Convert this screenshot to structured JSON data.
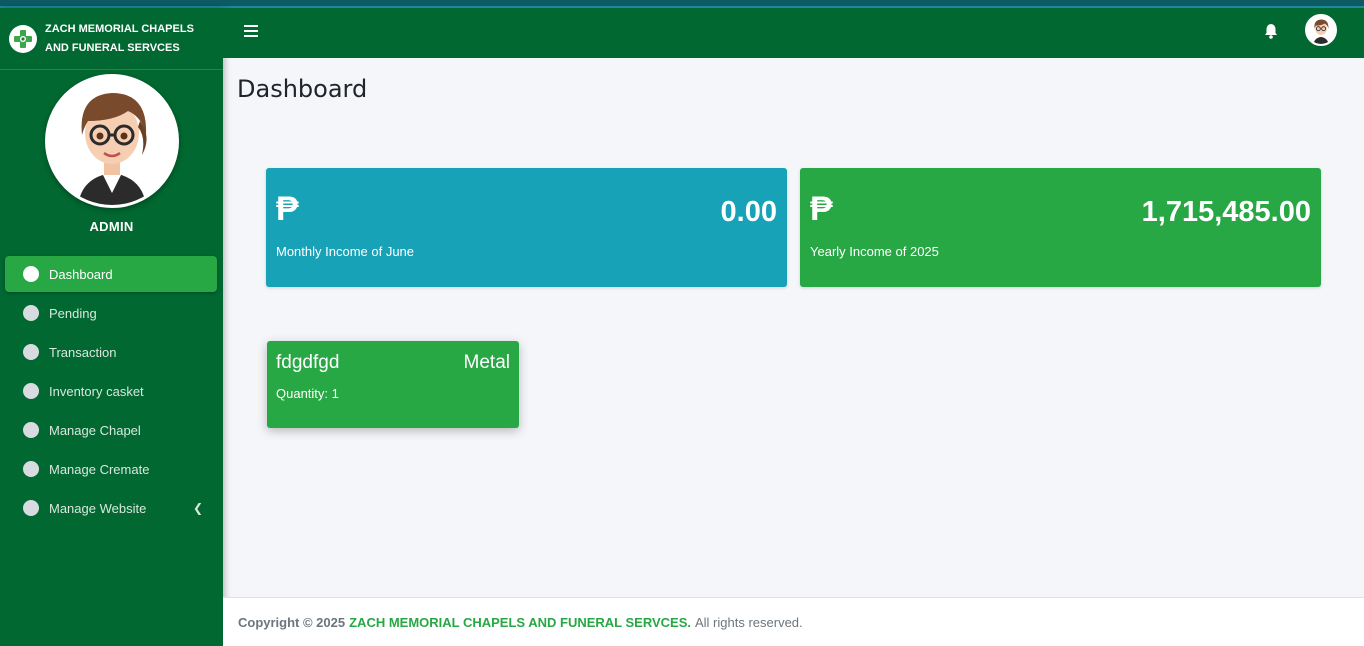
{
  "brand": {
    "line1": "ZACH MEMORIAL CHAPELS",
    "line2": "AND FUNERAL SERVCES",
    "logo_icon": "cross-emblem-icon"
  },
  "user": {
    "name": "ADMIN",
    "avatar_icon": "admin-avatar"
  },
  "sidebar": {
    "items": [
      {
        "label": "Dashboard",
        "active": true
      },
      {
        "label": "Pending"
      },
      {
        "label": "Transaction"
      },
      {
        "label": "Inventory casket"
      },
      {
        "label": "Manage Chapel"
      },
      {
        "label": "Manage Cremate"
      },
      {
        "label": "Manage Website",
        "icon": "chevron-left-icon"
      }
    ]
  },
  "header": {
    "menu_icon": "hamburger-icon",
    "notification_icon": "bell-icon"
  },
  "page": {
    "title": "Dashboard"
  },
  "cards": [
    {
      "symbol": "₱",
      "value": "0.00",
      "label": "Monthly Income of June",
      "color": "#17a2b8"
    },
    {
      "symbol": "₱",
      "value": "1,715,485.00",
      "label": "Yearly Income of 2025",
      "color": "#28a745"
    }
  ],
  "inventory": [
    {
      "name": "fdgdfgd",
      "type": "Metal",
      "quantity": "Quantity: 1"
    }
  ],
  "footer": {
    "prefix": "Copyright © 2025",
    "brand": "ZACH MEMORIAL CHAPELS AND FUNERAL SERVCES.",
    "suffix": "All rights reserved."
  },
  "colors": {
    "primary_green": "#006830",
    "accent_green": "#28a745",
    "info_blue": "#17a2b8"
  }
}
